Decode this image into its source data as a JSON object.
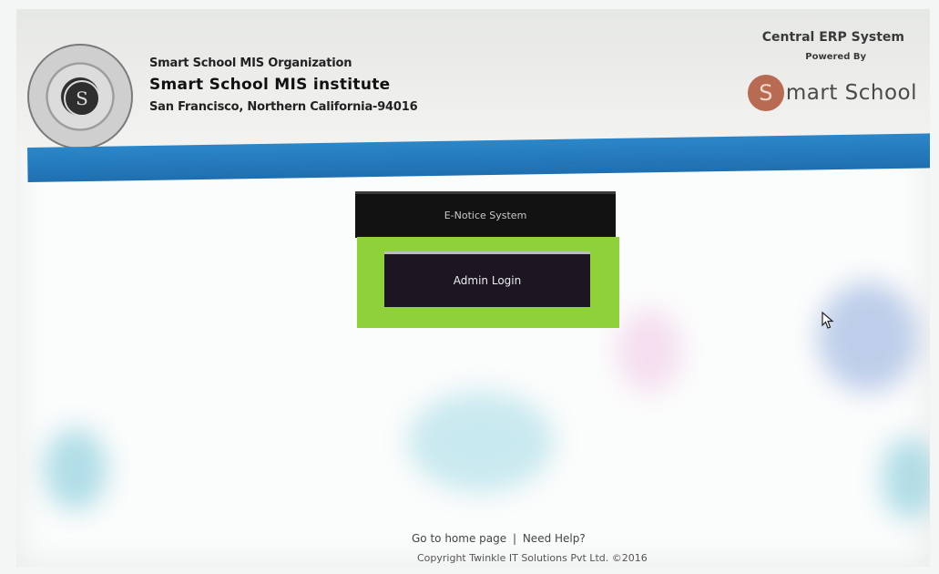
{
  "header": {
    "org_line1": "Smart School MIS Organization",
    "org_line2": "Smart School MIS institute",
    "org_line3": "San Francisco, Northern California-94016",
    "erp_title": "Central ERP System",
    "powered_by": "Powered By",
    "brand_initial": "S",
    "brand_word": "mart School",
    "seal_monogram": "S"
  },
  "main": {
    "notice_label": "E-Notice System",
    "admin_login_label": "Admin Login"
  },
  "footer": {
    "home_link": "Go to home page",
    "separator": "|",
    "help_link": "Need Help?",
    "copyright": "Copyright Twinkle IT Solutions Pvt Ltd. ©2016"
  },
  "colors": {
    "bluebar": "#1f6fb0",
    "green_panel": "#8fd13a",
    "button_bg": "#1c1622"
  }
}
